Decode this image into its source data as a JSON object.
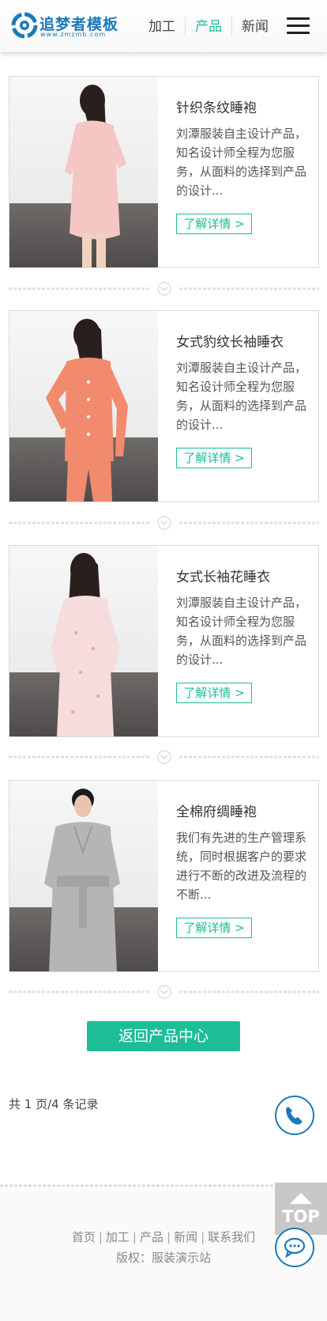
{
  "header": {
    "logo_text": "追梦者模板",
    "logo_sub": "www.zmzmb.com",
    "nav": [
      {
        "label": "加工",
        "active": false
      },
      {
        "label": "产品",
        "active": true
      },
      {
        "label": "新闻",
        "active": false
      }
    ],
    "menu_icon": "hamburger-menu-icon"
  },
  "products": [
    {
      "title": "针织条纹睡袍",
      "desc": "刘潭服装自主设计产品，知名设计师全程为您服务，从面料的选择到产品的设计...",
      "more": "了解详情 >",
      "garment_color": "#f4c6c4"
    },
    {
      "title": "女式豹纹长袖睡衣",
      "desc": "刘潭服装自主设计产品，知名设计师全程为您服务，从面料的选择到产品的设计...",
      "more": "了解详情 >",
      "garment_color": "#f28a6e"
    },
    {
      "title": "女式长袖花睡衣",
      "desc": "刘潭服装自主设计产品，知名设计师全程为您服务，从面料的选择到产品的设计...",
      "more": "了解详情 >",
      "garment_color": "#f6dcdc"
    },
    {
      "title": "全棉府绸睡袍",
      "desc": "我们有先进的生产管理系统，同时根据客户的要求进行不断的改进及流程的不断...",
      "more": "了解详情 >",
      "garment_color": "#b5b5b5"
    }
  ],
  "back_button": "返回产品中心",
  "pagination": "共 1 页/4 条记录",
  "footer": {
    "links": [
      "首页",
      "加工",
      "产品",
      "新闻",
      "联系我们"
    ],
    "copyright": "版权：服装演示站"
  },
  "floating": {
    "top_label": "TOP",
    "phone_icon": "phone-icon",
    "chat_icon": "chat-bubble-icon"
  },
  "colors": {
    "accent": "#1dbd97",
    "brand": "#1c79b9"
  }
}
